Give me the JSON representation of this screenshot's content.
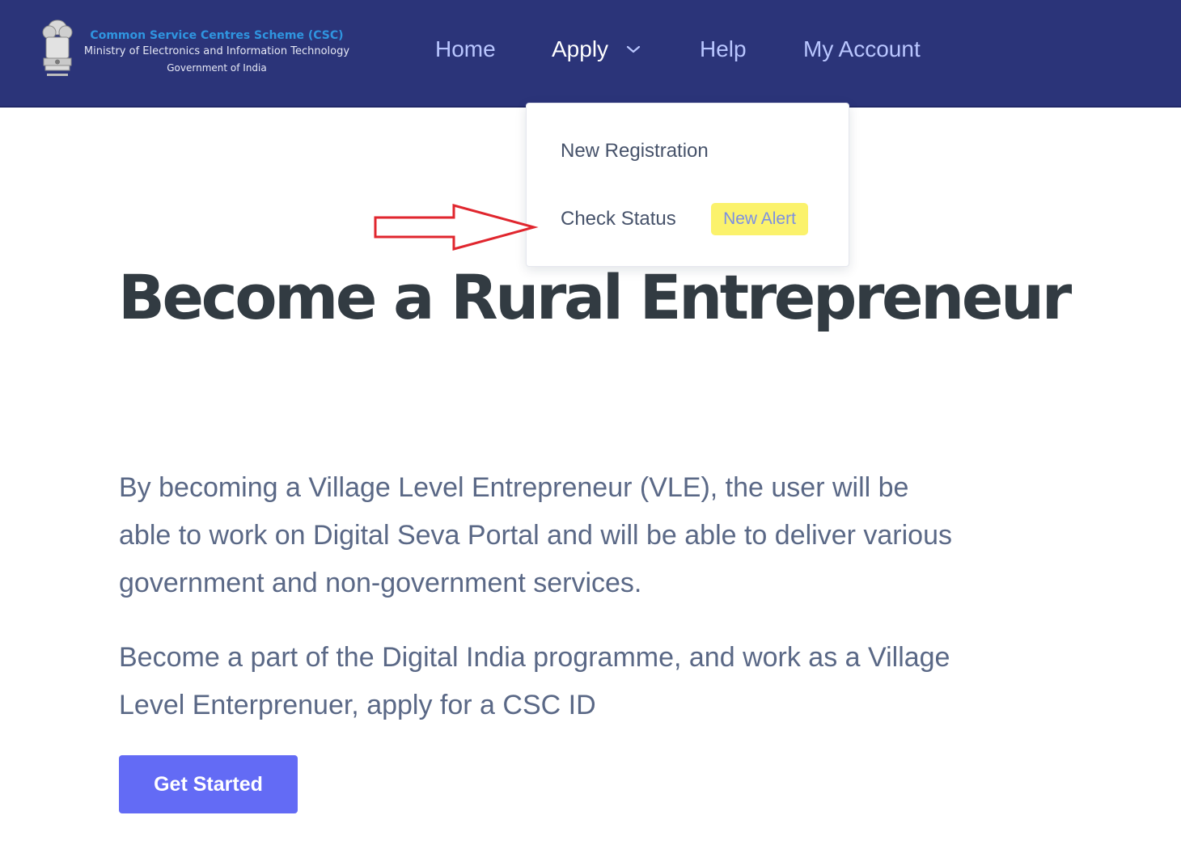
{
  "header": {
    "brand": {
      "line1": "Common Service Centres Scheme (CSC)",
      "line2": "Ministry of Electronics and Information Technology",
      "line3": "Government of India",
      "emblem_icon": "national-emblem-icon"
    },
    "nav": {
      "home": "Home",
      "apply": "Apply",
      "help": "Help",
      "my_account": "My Account"
    },
    "apply_dropdown": {
      "new_registration": "New Registration",
      "check_status": "Check Status",
      "badge": "New Alert"
    }
  },
  "main": {
    "title": "Become a Rural Entrepreneur",
    "paragraph1_line1": "By becoming a Village Level Entrepreneur (VLE), the user will be",
    "paragraph1_line2": "able to work on Digital Seva Portal and will be able to deliver various",
    "paragraph1_line3": "government and non-government services.",
    "paragraph2_line1": "Become a part of the Digital India programme, and work as a Village",
    "paragraph2_line2": "Level Enterprenuer, apply for a CSC ID",
    "cta_label": "Get Started"
  },
  "colors": {
    "navbar": "#2b3479",
    "nav_link": "#b9c6ff",
    "nav_active": "#ffffff",
    "brand_accent": "#2f95e0",
    "badge_bg": "#fbf26c",
    "badge_text": "#7b8fe3",
    "title": "#323b42",
    "body_text": "#5a6886",
    "cta": "#636bf5",
    "annotation_arrow": "#e0262e"
  }
}
